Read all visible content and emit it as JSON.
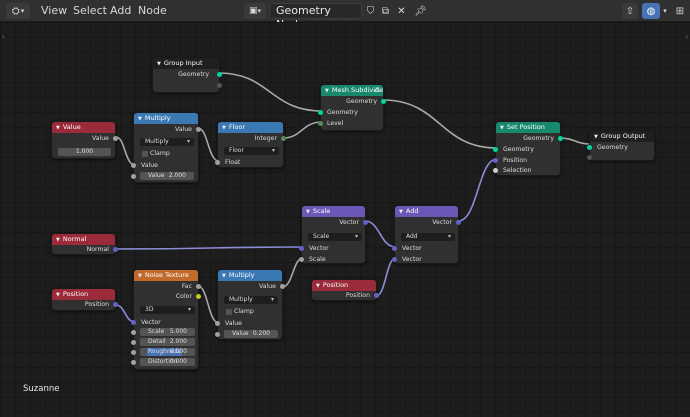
{
  "header": {
    "menus": [
      "View",
      "Select",
      "Add",
      "Node"
    ],
    "title": "Geometry Nodes"
  },
  "nodes": {
    "group_input": {
      "title": "Group Input",
      "geometry": "Geometry"
    },
    "mesh_subdivide": {
      "title": "Mesh Subdivide",
      "geometry_out": "Geometry",
      "geometry_in": "Geometry",
      "level": "Level"
    },
    "set_position": {
      "title": "Set Position",
      "geometry_out": "Geometry",
      "geometry_in": "Geometry",
      "position": "Position",
      "selection": "Selection"
    },
    "group_output": {
      "title": "Group Output",
      "geometry": "Geometry"
    },
    "value": {
      "title": "Value",
      "out": "Value",
      "field": "1.000"
    },
    "multiply1": {
      "title": "Multiply",
      "out": "Value",
      "op": "Multiply",
      "clamp": "Clamp",
      "in1": "Value",
      "in2_label": "Value",
      "in2_value": "2.000"
    },
    "floor": {
      "title": "Floor",
      "out": "Integer",
      "op": "Floor",
      "in": "Float"
    },
    "normal": {
      "title": "Normal",
      "out": "Normal"
    },
    "scale": {
      "title": "Scale",
      "out": "Vector",
      "op": "Scale",
      "vec": "Vector",
      "scale": "Scale"
    },
    "add": {
      "title": "Add",
      "out": "Vector",
      "op": "Add",
      "vec1": "Vector",
      "vec2": "Vector"
    },
    "position1": {
      "title": "Position",
      "out": "Position"
    },
    "noise": {
      "title": "Noise Texture",
      "fac": "Fac",
      "color": "Color",
      "dim": "3D",
      "vector": "Vector",
      "scale_l": "Scale",
      "scale_v": "5.000",
      "detail_l": "Detail",
      "detail_v": "2.000",
      "rough_l": "Roughness",
      "rough_v": "0.500",
      "dist_l": "Distortion",
      "dist_v": "0.000"
    },
    "multiply2": {
      "title": "Multiply",
      "out": "Value",
      "op": "Multiply",
      "clamp": "Clamp",
      "in1": "Value",
      "in2_label": "Value",
      "in2_value": "0.200"
    },
    "position2": {
      "title": "Position",
      "out": "Position"
    }
  },
  "object_name": "Suzanne"
}
